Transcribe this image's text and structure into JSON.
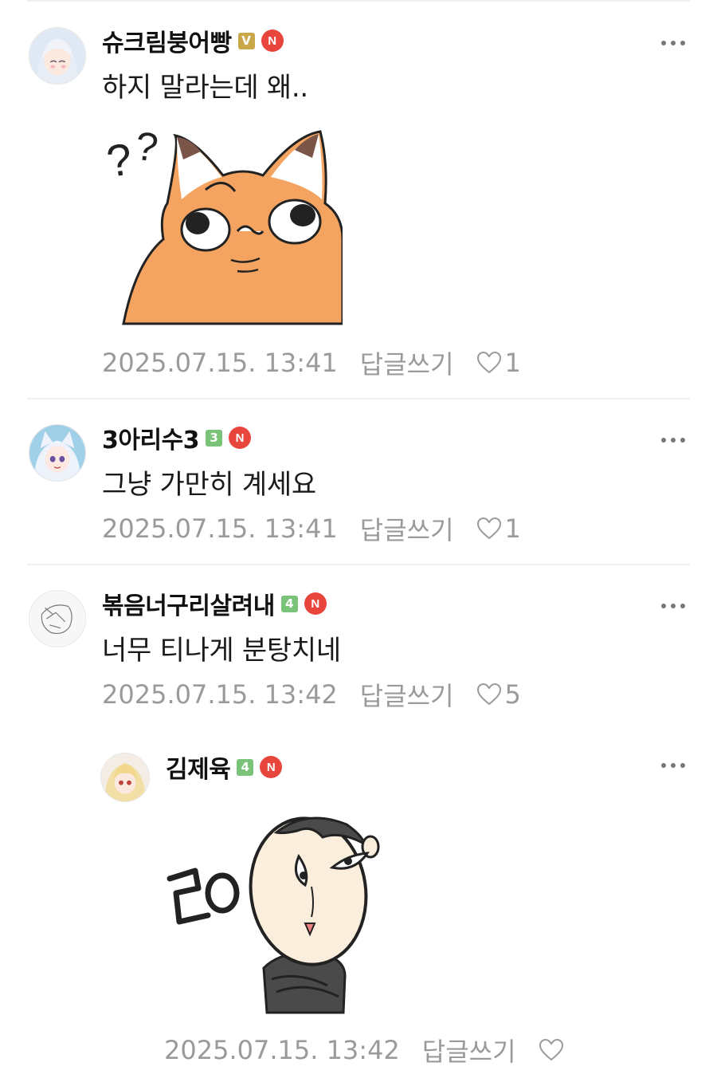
{
  "comments": [
    {
      "nick": "슈크림붕어빵",
      "badge_level": "V",
      "badge_color": "#c9a84a",
      "new_badge": "N",
      "text": "하지 말라는데 왜..",
      "sticker": "confused-fox-sticker",
      "date": "2025.07.15. 13:41",
      "reply": "답글쓰기",
      "likes": "1"
    },
    {
      "nick": "3아리수3",
      "badge_level": "3",
      "badge_color": "#7cc37a",
      "new_badge": "N",
      "text": "그냥 가만히 계세요",
      "date": "2025.07.15. 13:41",
      "reply": "답글쓰기",
      "likes": "1"
    },
    {
      "nick": "볶음너구리살려내",
      "badge_level": "4",
      "badge_color": "#7cc37a",
      "new_badge": "N",
      "text": "너무 티나게 분탕치네",
      "date": "2025.07.15. 13:42",
      "reply": "답글쓰기",
      "likes": "5"
    },
    {
      "nick": "김제육",
      "badge_level": "4",
      "badge_color": "#7cc37a",
      "new_badge": "N",
      "sticker": "bald-man-sticker",
      "sticker_text": "ㄹㅇ",
      "date": "2025.07.15. 13:42",
      "reply": "답글쓰기",
      "likes": ""
    }
  ],
  "icons": {
    "more": "more-dots-icon",
    "like": "heart-outline-icon",
    "new": "new-badge-icon"
  }
}
